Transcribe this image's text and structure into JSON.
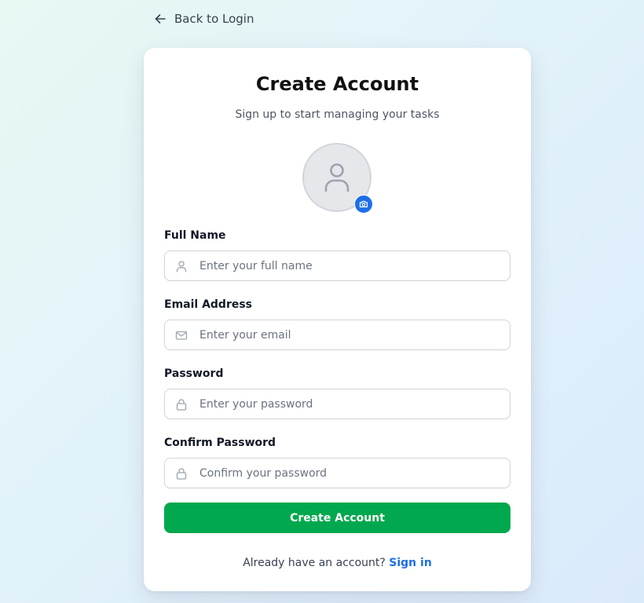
{
  "nav": {
    "back_label": "Back to Login",
    "back_icon": "arrow-left-icon"
  },
  "card": {
    "title": "Create Account",
    "subtitle": "Sign up to start managing your tasks"
  },
  "avatar": {
    "icon": "user-icon",
    "upload_icon": "camera-icon"
  },
  "fields": {
    "full_name": {
      "label": "Full Name",
      "placeholder": "Enter your full name",
      "value": "",
      "icon": "user-icon"
    },
    "email": {
      "label": "Email Address",
      "placeholder": "Enter your email",
      "value": "",
      "icon": "mail-icon"
    },
    "password": {
      "label": "Password",
      "placeholder": "Enter your password",
      "value": "",
      "icon": "lock-icon"
    },
    "confirm_password": {
      "label": "Confirm Password",
      "placeholder": "Confirm your password",
      "value": "",
      "icon": "lock-icon"
    }
  },
  "submit_label": "Create Account",
  "footer": {
    "text": "Already have an account?",
    "link_label": "Sign in"
  },
  "colors": {
    "primary_button": "#01a84d",
    "link": "#1d6fe8",
    "camera_badge": "#1d6fe8"
  }
}
